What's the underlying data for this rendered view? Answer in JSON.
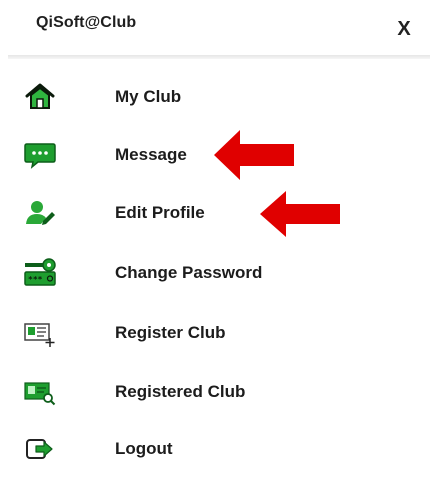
{
  "header": {
    "title": "QiSoft@Club",
    "close_label": "X"
  },
  "menu": {
    "items": [
      {
        "label": "My Club",
        "icon": "home-icon"
      },
      {
        "label": "Message",
        "icon": "chat-bubble-icon"
      },
      {
        "label": "Edit Profile",
        "icon": "user-edit-icon"
      },
      {
        "label": "Change Password",
        "icon": "key-password-icon"
      },
      {
        "label": "Register Club",
        "icon": "id-card-add-icon"
      },
      {
        "label": "Registered Club",
        "icon": "id-card-search-icon"
      },
      {
        "label": "Logout",
        "icon": "logout-icon"
      }
    ]
  },
  "annotations": {
    "arrow_color": "#e00000",
    "arrows_point_to": [
      "Message",
      "Edit Profile"
    ]
  },
  "colors": {
    "icon_green": "#1e9e2f",
    "icon_dark_green": "#0d5e1a"
  }
}
